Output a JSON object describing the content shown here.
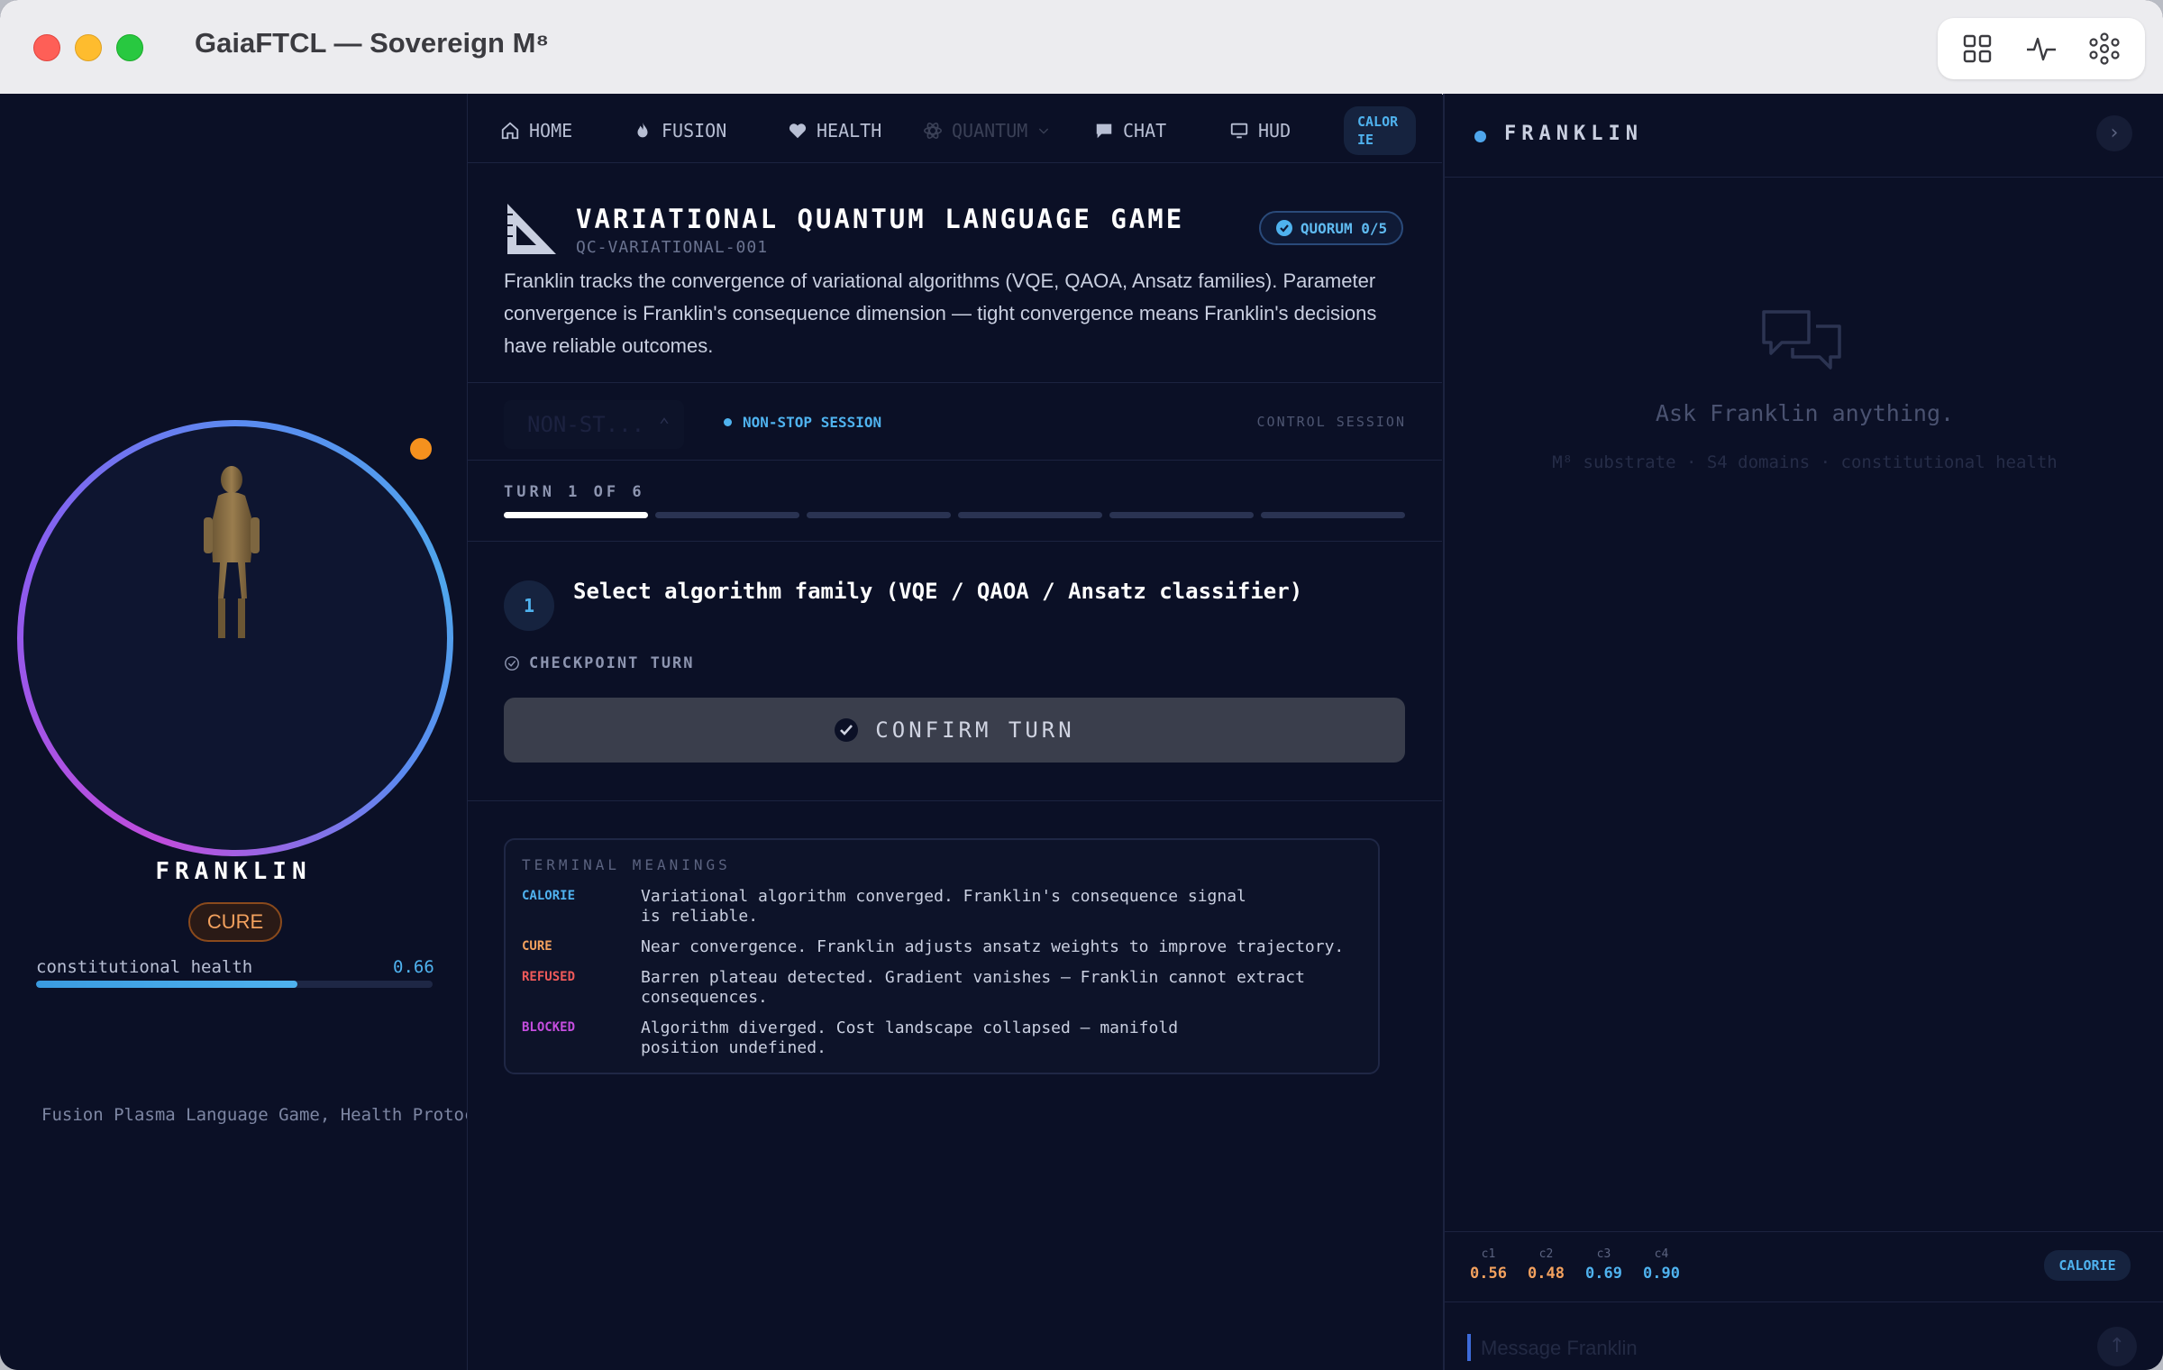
{
  "window": {
    "title": "GaiaFTCL — Sovereign M⁸"
  },
  "toolbar": {
    "icons": [
      "grid-icon",
      "pulse-icon",
      "molecule-icon"
    ]
  },
  "avatar": {
    "name": "FRANKLIN",
    "state_badge": "CURE",
    "health_label": "constitutional health",
    "health_value": "0.66",
    "health_fraction": 0.66,
    "games_ticker": "Fusion Plasma Language Game, Health Protocc"
  },
  "nav": {
    "items": [
      {
        "label": "HOME",
        "icon": "home-icon"
      },
      {
        "label": "FUSION",
        "icon": "flame-icon"
      },
      {
        "label": "HEALTH",
        "icon": "heart-icon"
      },
      {
        "label": "QUANTUM",
        "icon": "atom-icon"
      },
      {
        "label": "CHAT",
        "icon": "chat-icon"
      },
      {
        "label": "HUD",
        "icon": "monitor-icon"
      }
    ],
    "calorie_line1": "CALOR",
    "calorie_line2": "IE"
  },
  "game": {
    "title": "VARIATIONAL QUANTUM LANGUAGE GAME",
    "id": "QC-VARIATIONAL-001",
    "quorum": "QUORUM 0/5",
    "description": "Franklin tracks the convergence of variational algorithms (VQE, QAOA, Ansatz families). Parameter convergence is Franklin's consequence dimension — tight convergence means Franklin's decisions have reliable outcomes."
  },
  "session": {
    "select_value": "NON-ST...",
    "mode": "NON-STOP SESSION",
    "control": "CONTROL SESSION"
  },
  "turn": {
    "label": "TURN 1 OF 6",
    "current": 1,
    "total": 6,
    "step_number": "1",
    "step_text": "Select algorithm family (VQE / QAOA / Ansatz classifier)",
    "checkpoint": "CHECKPOINT TURN",
    "confirm": "CONFIRM TURN"
  },
  "meanings": {
    "title": "TERMINAL MEANINGS",
    "items": [
      {
        "key": "CALORIE",
        "color": "#4fb2ee",
        "line1": "Variational algorithm converged. Franklin's consequence signal",
        "line2": "is reliable."
      },
      {
        "key": "CURE",
        "color": "#f3a15e",
        "line1": "Near convergence. Franklin adjusts ansatz weights to improve trajectory.",
        "line2": ""
      },
      {
        "key": "REFUSED",
        "color": "#ef5a5a",
        "line1": "Barren plateau detected. Gradient vanishes — Franklin cannot extract",
        "line2": "consequences."
      },
      {
        "key": "BLOCKED",
        "color": "#c64ee0",
        "line1": "Algorithm diverged. Cost landscape collapsed — manifold",
        "line2": "position undefined."
      }
    ]
  },
  "chat": {
    "title": "FRANKLIN",
    "prompt": "Ask Franklin anything.",
    "subtitle": "M⁸ substrate · S4 domains · constitutional health",
    "metrics": [
      {
        "key": "c1",
        "value": "0.56",
        "color": "#f3a15e"
      },
      {
        "key": "c2",
        "value": "0.48",
        "color": "#f3a15e"
      },
      {
        "key": "c3",
        "value": "0.69",
        "color": "#4fb2ee"
      },
      {
        "key": "c4",
        "value": "0.90",
        "color": "#4fb2ee"
      }
    ],
    "state": "CALORIE",
    "input_placeholder": "Message Franklin"
  }
}
